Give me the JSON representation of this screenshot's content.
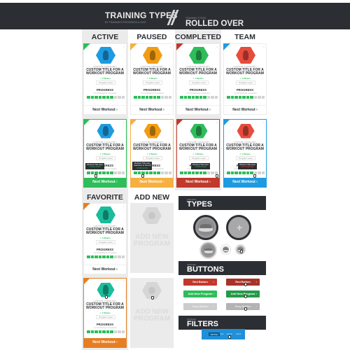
{
  "header": {
    "title": "TRAINING TYPES",
    "subtitle": "BY TRAINING'S PROGRESS & STAT",
    "right_small": "TRAINING TYPES",
    "right_big": "ROLLED OVER"
  },
  "card_defaults": {
    "category": "CUSTOM CATEGORY",
    "title_line1": "CUSTOM TITLE FOR A",
    "title_line2": "WORKOUT PROGRAM",
    "weeks": "✓ 4 Weeks",
    "level": "Program Level",
    "progress_label": "PROGRESS",
    "progress_sub": "7 of 10 Workouts Completed",
    "next_label": "Next Workout ›",
    "close": "×",
    "progress_filled": 7,
    "progress_total": 10
  },
  "columns": [
    {
      "title": "ACTIVE",
      "color": "#1e9be0",
      "corner_color": "#2ebd59",
      "corner": "✓"
    },
    {
      "title": "PAUSED",
      "color": "#f39c12",
      "corner_color": "#f5b041",
      "corner": "II"
    },
    {
      "title": "COMPLETED",
      "color": "#2ebd59",
      "corner_color": "#c0392b",
      "corner": "✓"
    },
    {
      "title": "TEAM",
      "color": "#e74c3c",
      "corner_color": "#1e9be0",
      "corner": ""
    },
    {
      "title": "FAVORITE",
      "color": "#1abc9c",
      "corner_color": "#e67e22",
      "corner": "★"
    },
    {
      "title": "ADD NEW",
      "placeholder_line1": "ADD NEW",
      "placeholder_line2": "PROGRAM"
    }
  ],
  "rollover": {
    "card_colors": [
      "#2ebd59",
      "#f5b041",
      "#c0392b",
      "#1e9be0"
    ],
    "tooltips": [
      {
        "title": "Workout Title Here",
        "status": "COMPLETED",
        "status_color": "#2ebd59"
      },
      {
        "title": "Workout Title Here",
        "title2": "maximum to the left",
        "status": "COMPLETED",
        "status_color": "#2ebd59"
      },
      {
        "title": "Workout Title Here",
        "status": "COMPLETED",
        "status_color": "#2ebd59"
      },
      {
        "title": "Workout Title Here",
        "status": "NOT STARTED",
        "status_color": "#e74c3c"
      }
    ],
    "favorite_color": "#e67e22"
  },
  "sections": {
    "types": {
      "small": "AVATAR",
      "big": "TYPES"
    },
    "buttons": {
      "small": "INPAGE",
      "big": "BUTTONS"
    },
    "filters": {
      "small": "INPAGE",
      "big": "FILTERS"
    }
  },
  "buttons": [
    {
      "label": "Red Button",
      "color": "#c0392b",
      "hover_color": "#a93226"
    },
    {
      "label": "Add New Program",
      "color": "#2ebd59",
      "hover_color": "#239a48"
    },
    {
      "label": "Gray Button",
      "color": "#cccccc",
      "hover_color": "#b3b3b3"
    }
  ],
  "button_chevron": "›",
  "filters": {
    "options": [
      "All Time",
      "Year",
      "Month",
      "Week"
    ],
    "active": "All Time",
    "color": "#1f90d9"
  }
}
